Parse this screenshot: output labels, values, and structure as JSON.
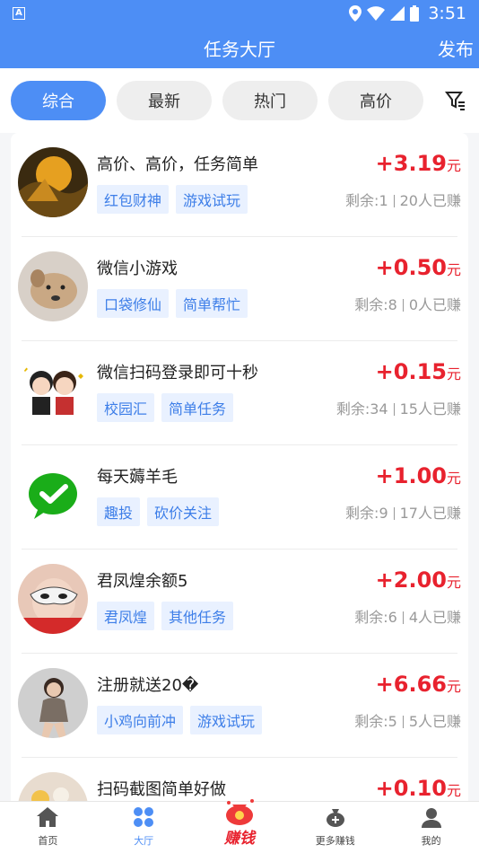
{
  "status": {
    "time": "3:51",
    "notif": "A"
  },
  "header": {
    "title": "任务大厅",
    "publish": "发布"
  },
  "tabs": [
    {
      "label": "综合",
      "active": true
    },
    {
      "label": "最新",
      "active": false
    },
    {
      "label": "热门",
      "active": false
    },
    {
      "label": "高价",
      "active": false
    }
  ],
  "tasks": [
    {
      "title": "高价、高价，任务简单",
      "price_sign": "+",
      "price": "3.19",
      "unit": "元",
      "tags": [
        "红包财神",
        "游戏试玩"
      ],
      "remaining": "剩余:1",
      "earned": "20人已赚",
      "avatar": "sunset"
    },
    {
      "title": "微信小游戏",
      "price_sign": "+",
      "price": "0.50",
      "unit": "元",
      "tags": [
        "口袋修仙",
        "简单帮忙"
      ],
      "remaining": "剩余:8",
      "earned": "0人已赚",
      "avatar": "dog"
    },
    {
      "title": "微信扫码登录即可十秒",
      "price_sign": "+",
      "price": "0.15",
      "unit": "元",
      "tags": [
        "校园汇",
        "简单任务"
      ],
      "remaining": "剩余:34",
      "earned": "15人已赚",
      "avatar": "cartoon"
    },
    {
      "title": "每天薅羊毛",
      "price_sign": "+",
      "price": "1.00",
      "unit": "元",
      "tags": [
        "趣投",
        "砍价关注"
      ],
      "remaining": "剩余:9",
      "earned": "17人已赚",
      "avatar": "wechat"
    },
    {
      "title": "君凤煌余额5",
      "price_sign": "+",
      "price": "2.00",
      "unit": "元",
      "tags": [
        "君凤煌",
        "其他任务"
      ],
      "remaining": "剩余:6",
      "earned": "4人已赚",
      "avatar": "mask"
    },
    {
      "title": "注册就送20�",
      "price_sign": "+",
      "price": "6.66",
      "unit": "元",
      "tags": [
        "小鸡向前冲",
        "游戏试玩"
      ],
      "remaining": "剩余:5",
      "earned": "5人已赚",
      "avatar": "girl"
    },
    {
      "title": "扫码截图简单好做",
      "price_sign": "+",
      "price": "0.10",
      "unit": "元",
      "tags": [],
      "remaining": "",
      "earned": "",
      "avatar": "flowers"
    }
  ],
  "nav": [
    {
      "label": "首页",
      "icon": "home-icon",
      "active": false
    },
    {
      "label": "大厅",
      "icon": "hall-icon",
      "active": true
    },
    {
      "label": "赚钱",
      "icon": "money-bag-icon",
      "active": false
    },
    {
      "label": "更多赚钱",
      "icon": "bag-plus-icon",
      "active": false
    },
    {
      "label": "我的",
      "icon": "user-icon",
      "active": false
    }
  ],
  "colors": {
    "primary": "#4d8ef5",
    "price": "#e8222e",
    "tag_bg": "#e9f1ff",
    "tag_text": "#3d7ee8"
  }
}
